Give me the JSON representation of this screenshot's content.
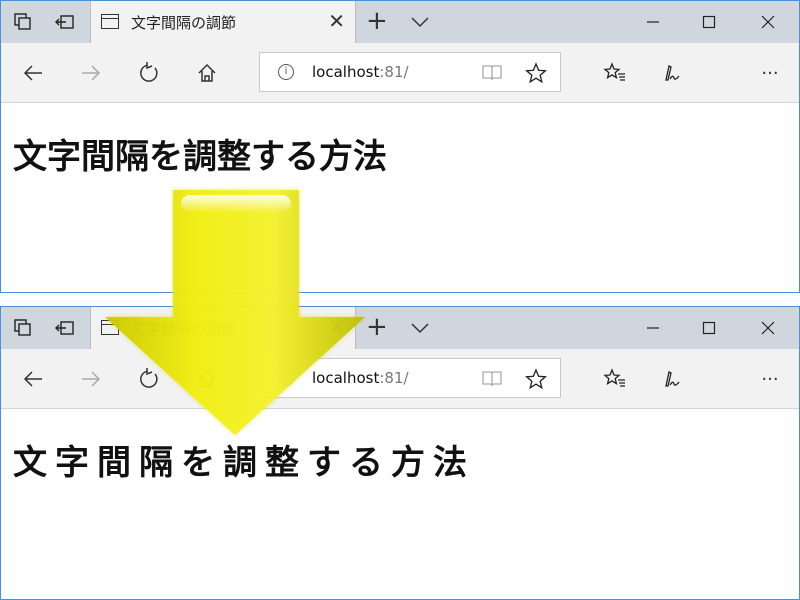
{
  "tab": {
    "title": "文字間隔の調節",
    "close_symbol": "✕"
  },
  "toolbar": {
    "new_tab_symbol": "+",
    "more_symbol": "···"
  },
  "address": {
    "host": "localhost",
    "port": ":81/"
  },
  "page": {
    "heading": "文字間隔を調整する方法"
  },
  "colors": {
    "arrow": "#e8e600",
    "titlebar": "#cfd6de",
    "toolbar": "#f2f2f2",
    "window_border": "#4a90d9"
  },
  "icons": [
    "tab-overview-icon",
    "set-aside-tabs-icon",
    "page-icon",
    "close-icon",
    "plus-icon",
    "chevron-down-icon",
    "minimize-icon",
    "maximize-icon",
    "back-icon",
    "forward-icon",
    "refresh-icon",
    "home-icon",
    "info-icon",
    "reading-view-icon",
    "favorite-star-icon",
    "favorites-hub-icon",
    "pen-icon",
    "more-icon",
    "down-arrow-icon"
  ]
}
